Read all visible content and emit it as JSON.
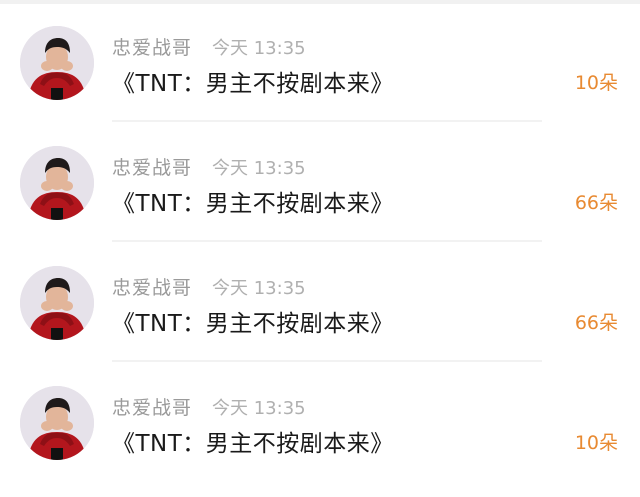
{
  "messages": [
    {
      "user": "忠爱战哥",
      "time": "今天 13:35",
      "text": "《TNT：男主不按剧本来》",
      "gift": "10朵"
    },
    {
      "user": "忠爱战哥",
      "time": "今天 13:35",
      "text": "《TNT：男主不按剧本来》",
      "gift": "66朵"
    },
    {
      "user": "忠爱战哥",
      "time": "今天 13:35",
      "text": "《TNT：男主不按剧本来》",
      "gift": "66朵"
    },
    {
      "user": "忠爱战哥",
      "time": "今天 13:35",
      "text": "《TNT：男主不按剧本来》",
      "gift": "10朵"
    }
  ],
  "colors": {
    "gift_accent": "#e88a32",
    "name_gray": "#9a9a9a",
    "time_gray": "#b0b0b0",
    "text_dark": "#1a1a1a"
  },
  "icons": {
    "avatar": "user-avatar-photo"
  }
}
